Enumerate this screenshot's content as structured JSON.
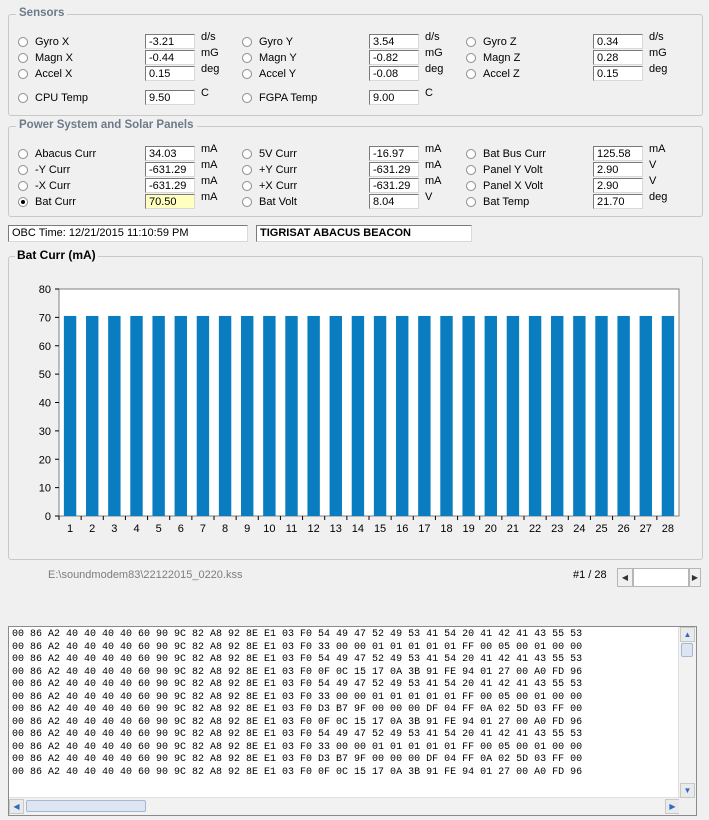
{
  "sensors": {
    "title": "Sensors",
    "rows": [
      [
        {
          "label": "Gyro X",
          "value": "-3.21",
          "unit": "d/s"
        },
        {
          "label": "Gyro Y",
          "value": "3.54",
          "unit": "d/s"
        },
        {
          "label": "Gyro Z",
          "value": "0.34",
          "unit": "d/s"
        }
      ],
      [
        {
          "label": "Magn X",
          "value": "-0.44",
          "unit": "mG"
        },
        {
          "label": "Magn Y",
          "value": "-0.82",
          "unit": "mG"
        },
        {
          "label": "Magn Z",
          "value": "0.28",
          "unit": "mG"
        }
      ],
      [
        {
          "label": "Accel X",
          "value": "0.15",
          "unit": "deg"
        },
        {
          "label": "Accel Y",
          "value": "-0.08",
          "unit": "deg"
        },
        {
          "label": "Accel Z",
          "value": "0.15",
          "unit": "deg"
        }
      ],
      [
        {
          "label": "CPU Temp",
          "value": "9.50",
          "unit": "C"
        },
        {
          "label": "FGPA Temp",
          "value": "9.00",
          "unit": "C"
        }
      ]
    ]
  },
  "power": {
    "title": "Power System and Solar Panels",
    "rows": [
      [
        {
          "label": "Abacus Curr",
          "value": "34.03",
          "unit": "mA"
        },
        {
          "label": "5V Curr",
          "value": "-16.97",
          "unit": "mA"
        },
        {
          "label": "Bat Bus Curr",
          "value": "125.58",
          "unit": "mA"
        }
      ],
      [
        {
          "label": "-Y Curr",
          "value": "-631.29",
          "unit": "mA"
        },
        {
          "label": "+Y Curr",
          "value": "-631.29",
          "unit": "mA"
        },
        {
          "label": "Panel Y Volt",
          "value": "2.90",
          "unit": "V"
        }
      ],
      [
        {
          "label": "-X Curr",
          "value": "-631.29",
          "unit": "mA"
        },
        {
          "label": "+X Curr",
          "value": "-631.29",
          "unit": "mA"
        },
        {
          "label": "Panel X Volt",
          "value": "2.90",
          "unit": "V"
        }
      ],
      [
        {
          "label": "Bat Curr",
          "value": "70.50",
          "unit": "mA",
          "checked": true,
          "highlight": true
        },
        {
          "label": "Bat Volt",
          "value": "8.04",
          "unit": "V"
        },
        {
          "label": "Bat Temp",
          "value": "21.70",
          "unit": "deg"
        }
      ]
    ]
  },
  "obc_time": "OBC Time: 12/21/2015 11:10:59 PM",
  "beacon": "TIGRISAT ABACUS BEACON",
  "chart_data": {
    "type": "bar",
    "title": "Bat Curr (mA)",
    "categories": [
      "1",
      "2",
      "3",
      "4",
      "5",
      "6",
      "7",
      "8",
      "9",
      "10",
      "11",
      "12",
      "13",
      "14",
      "15",
      "16",
      "17",
      "18",
      "19",
      "20",
      "21",
      "22",
      "23",
      "24",
      "25",
      "26",
      "27",
      "28"
    ],
    "values": [
      70.5,
      70.5,
      70.5,
      70.5,
      70.5,
      70.5,
      70.5,
      70.5,
      70.5,
      70.5,
      70.5,
      70.5,
      70.5,
      70.5,
      70.5,
      70.5,
      70.5,
      70.5,
      70.5,
      70.5,
      70.5,
      70.5,
      70.5,
      70.5,
      70.5,
      70.5,
      70.5,
      70.5
    ],
    "yticks": [
      "0",
      "10",
      "20",
      "30",
      "40",
      "50",
      "60",
      "70",
      "80"
    ],
    "ylim": [
      0,
      80
    ],
    "bar_color": "#0a7dc0",
    "grid": false
  },
  "file_path": "E:\\soundmodem83\\22122015_0220.kss",
  "pager": "#1 / 28",
  "hex_lines": [
    "00 86 A2 40 40 40 40 60 90 9C 82 A8 92 8E E1 03 F0 54 49 47 52 49 53 41 54 20 41 42 41 43 55 53",
    "00 86 A2 40 40 40 40 60 90 9C 82 A8 92 8E E1 03 F0 33 00 00 01 01 01 01 01 FF 00 05 00 01 00 00",
    "00 86 A2 40 40 40 40 60 90 9C 82 A8 92 8E E1 03 F0 54 49 47 52 49 53 41 54 20 41 42 41 43 55 53",
    "00 86 A2 40 40 40 40 60 90 9C 82 A8 92 8E E1 03 F0 0F 0C 15 17 0A 3B 91 FE 94 01 27 00 A0 FD 96",
    "00 86 A2 40 40 40 40 60 90 9C 82 A8 92 8E E1 03 F0 54 49 47 52 49 53 41 54 20 41 42 41 43 55 53",
    "00 86 A2 40 40 40 40 60 90 9C 82 A8 92 8E E1 03 F0 33 00 00 01 01 01 01 01 FF 00 05 00 01 00 00",
    "00 86 A2 40 40 40 40 60 90 9C 82 A8 92 8E E1 03 F0 D3 B7 9F 00 00 00 DF 04 FF 0A 02 5D 03 FF 00",
    "00 86 A2 40 40 40 40 60 90 9C 82 A8 92 8E E1 03 F0 0F 0C 15 17 0A 3B 91 FE 94 01 27 00 A0 FD 96",
    "00 86 A2 40 40 40 40 60 90 9C 82 A8 92 8E E1 03 F0 54 49 47 52 49 53 41 54 20 41 42 41 43 55 53",
    "00 86 A2 40 40 40 40 60 90 9C 82 A8 92 8E E1 03 F0 33 00 00 01 01 01 01 01 FF 00 05 00 01 00 00",
    "00 86 A2 40 40 40 40 60 90 9C 82 A8 92 8E E1 03 F0 D3 B7 9F 00 00 00 DF 04 FF 0A 02 5D 03 FF 00",
    "00 86 A2 40 40 40 40 60 90 9C 82 A8 92 8E E1 03 F0 0F 0C 15 17 0A 3B 91 FE 94 01 27 00 A0 FD 96"
  ]
}
